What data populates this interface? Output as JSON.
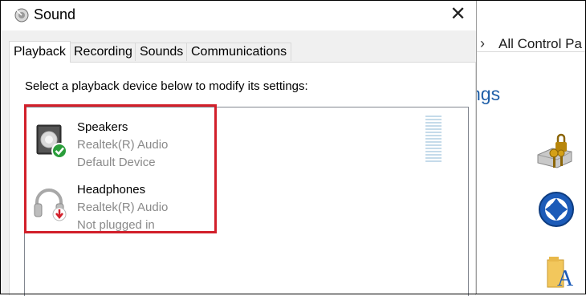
{
  "background_window": {
    "address_path": "All Control Pa",
    "heading_fragment": "ngs"
  },
  "dialog": {
    "title": "Sound",
    "close_glyph": "✕",
    "tabs": [
      {
        "label": "Playback",
        "active": true
      },
      {
        "label": "Recording",
        "active": false
      },
      {
        "label": "Sounds",
        "active": false
      },
      {
        "label": "Communications",
        "active": false
      }
    ],
    "instruction": "Select a playback device below to modify its settings:",
    "devices": [
      {
        "name": "Speakers",
        "driver": "Realtek(R) Audio",
        "status": "Default Device",
        "badge": "check",
        "badge_color": "#2a9d3a"
      },
      {
        "name": "Headphones",
        "driver": "Realtek(R) Audio",
        "status": "Not plugged in",
        "badge": "down-arrow",
        "badge_color": "#d21f2a"
      }
    ],
    "highlight_color": "#d21f2a",
    "meter_level": 0
  }
}
